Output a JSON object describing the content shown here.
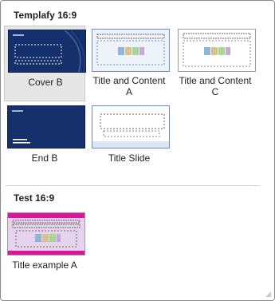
{
  "sections": [
    {
      "title": "Templafy 16:9",
      "layouts": [
        {
          "label": "Cover B",
          "label2": "",
          "style": "navy"
        },
        {
          "label": "Title and Content",
          "label2": "A",
          "style": "light"
        },
        {
          "label": "Title and Content",
          "label2": "C",
          "style": "white"
        },
        {
          "label": "End B",
          "label2": "",
          "style": "navy"
        },
        {
          "label": "Title Slide",
          "label2": "",
          "style": "white"
        }
      ]
    },
    {
      "title": "Test 16:9",
      "layouts": [
        {
          "label": "Title example A",
          "label2": "",
          "style": "pink"
        }
      ]
    }
  ],
  "colors": {
    "navy": "#15306b",
    "accent_pink": "#e0139c",
    "selected_bg": "#e6e6e6"
  },
  "icons": {
    "resize": "resize-grip-icon"
  }
}
